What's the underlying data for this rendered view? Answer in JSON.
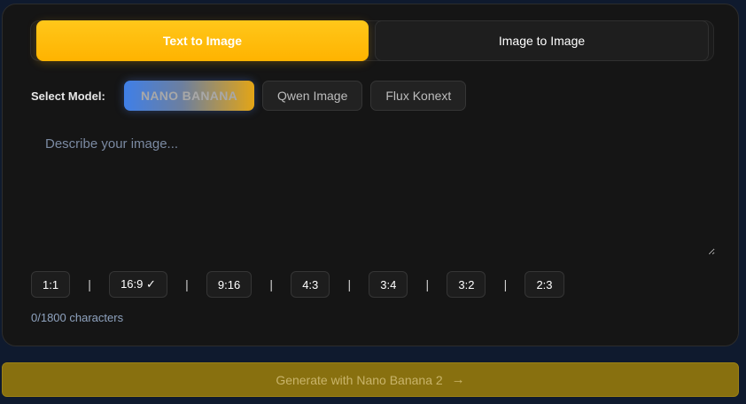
{
  "mode_tabs": {
    "text_to_image": "Text to Image",
    "image_to_image": "Image to Image"
  },
  "models": {
    "label": "Select Model:",
    "items": [
      "NANO BANANA",
      "Qwen Image",
      "Flux Konext"
    ],
    "selected": "NANO BANANA"
  },
  "prompt": {
    "placeholder": "Describe your image...",
    "value": ""
  },
  "ratios": {
    "items": [
      "1:1",
      "16:9 ✓",
      "9:16",
      "4:3",
      "3:4",
      "3:2",
      "2:3"
    ],
    "separator": "|"
  },
  "char_count": "0/1800 characters",
  "generate": {
    "label": "Generate with Nano Banana 2",
    "icon": "arrow-right-icon"
  },
  "colors": {
    "active_tab": "#ffbb0a",
    "generate_bg": "#88700f",
    "panel_bg": "#151515",
    "page_bg": "#0f1a2e"
  }
}
